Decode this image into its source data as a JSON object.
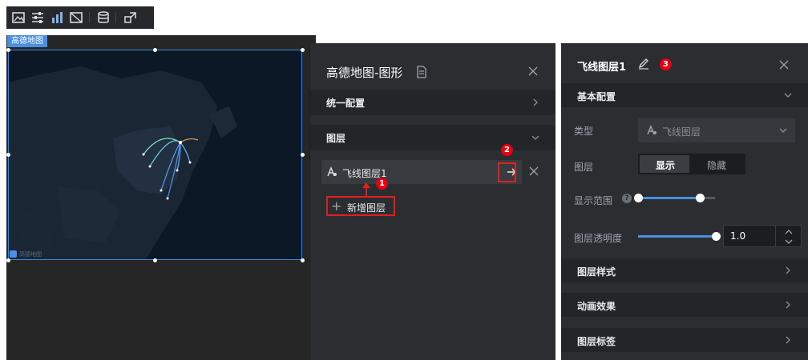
{
  "toolbar": {
    "items": [
      {
        "icon": "image-icon"
      },
      {
        "icon": "sliders-icon"
      },
      {
        "icon": "bar-chart-icon"
      },
      {
        "icon": "frame-icon"
      },
      {
        "icon": "database-icon"
      },
      {
        "icon": "interaction-icon"
      }
    ]
  },
  "canvas": {
    "component_tag": "高德地图",
    "map_logo_text": "高德地图"
  },
  "middle_panel": {
    "title": "高德地图-图形",
    "sections": {
      "unified_config": "统一配置",
      "layers": "图层"
    },
    "layer_item": {
      "name": "飞线图层1"
    },
    "add_layer_label": "新增图层"
  },
  "right_panel": {
    "title": "飞线图层1",
    "basic_config": "基本配置",
    "type_label": "类型",
    "type_value": "飞线图层",
    "layer_label": "图层",
    "show_label": "显示",
    "hide_label": "隐藏",
    "visibility_selected": "显示",
    "display_range_label": "显示范围",
    "opacity_label": "图层透明度",
    "opacity_value": "1.0",
    "sections": [
      "图层样式",
      "动画效果",
      "图层标签"
    ]
  },
  "annotations": [
    "1",
    "2",
    "3"
  ],
  "colors": {
    "panel_bg": "#2b2d31",
    "section_bg": "#232528",
    "accent_blue": "#4a8fe0",
    "annotation_red": "#e02020"
  }
}
